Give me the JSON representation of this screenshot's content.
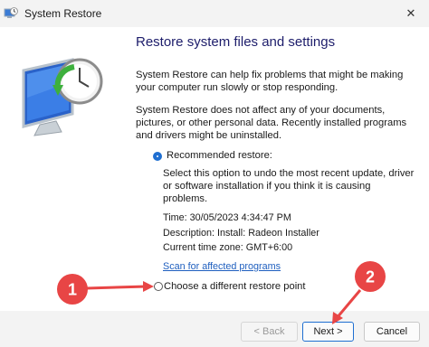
{
  "window": {
    "title": "System Restore",
    "icon": "system-restore-icon",
    "close_glyph": "✕"
  },
  "main": {
    "heading": "Restore system files and settings",
    "para1": "System Restore can help fix problems that might be making your computer run slowly or stop responding.",
    "para2": "System Restore does not affect any of your documents, pictures, or other personal data. Recently installed programs and drivers might be uninstalled.",
    "recommended": {
      "label": "Recommended restore:",
      "selected": true,
      "description": "Select this option to undo the most recent update, driver or software installation if you think it is causing problems.",
      "time": "Time: 30/05/2023 4:34:47 PM",
      "desc": "Description: Install: Radeon Installer",
      "timezone": "Current time zone: GMT+6:00",
      "scan_link": "Scan for affected programs"
    },
    "different": {
      "label": "Choose a different restore point",
      "selected": false
    }
  },
  "footer": {
    "back_label": "< Back",
    "next_label": "Next >",
    "cancel_label": "Cancel"
  },
  "annotations": {
    "badge1": "1",
    "badge2": "2",
    "color": "#e84545"
  },
  "colors": {
    "accent": "#1f6fd1",
    "heading": "#1d1d6b",
    "link": "#1f5fbf",
    "annotation": "#e84545"
  }
}
